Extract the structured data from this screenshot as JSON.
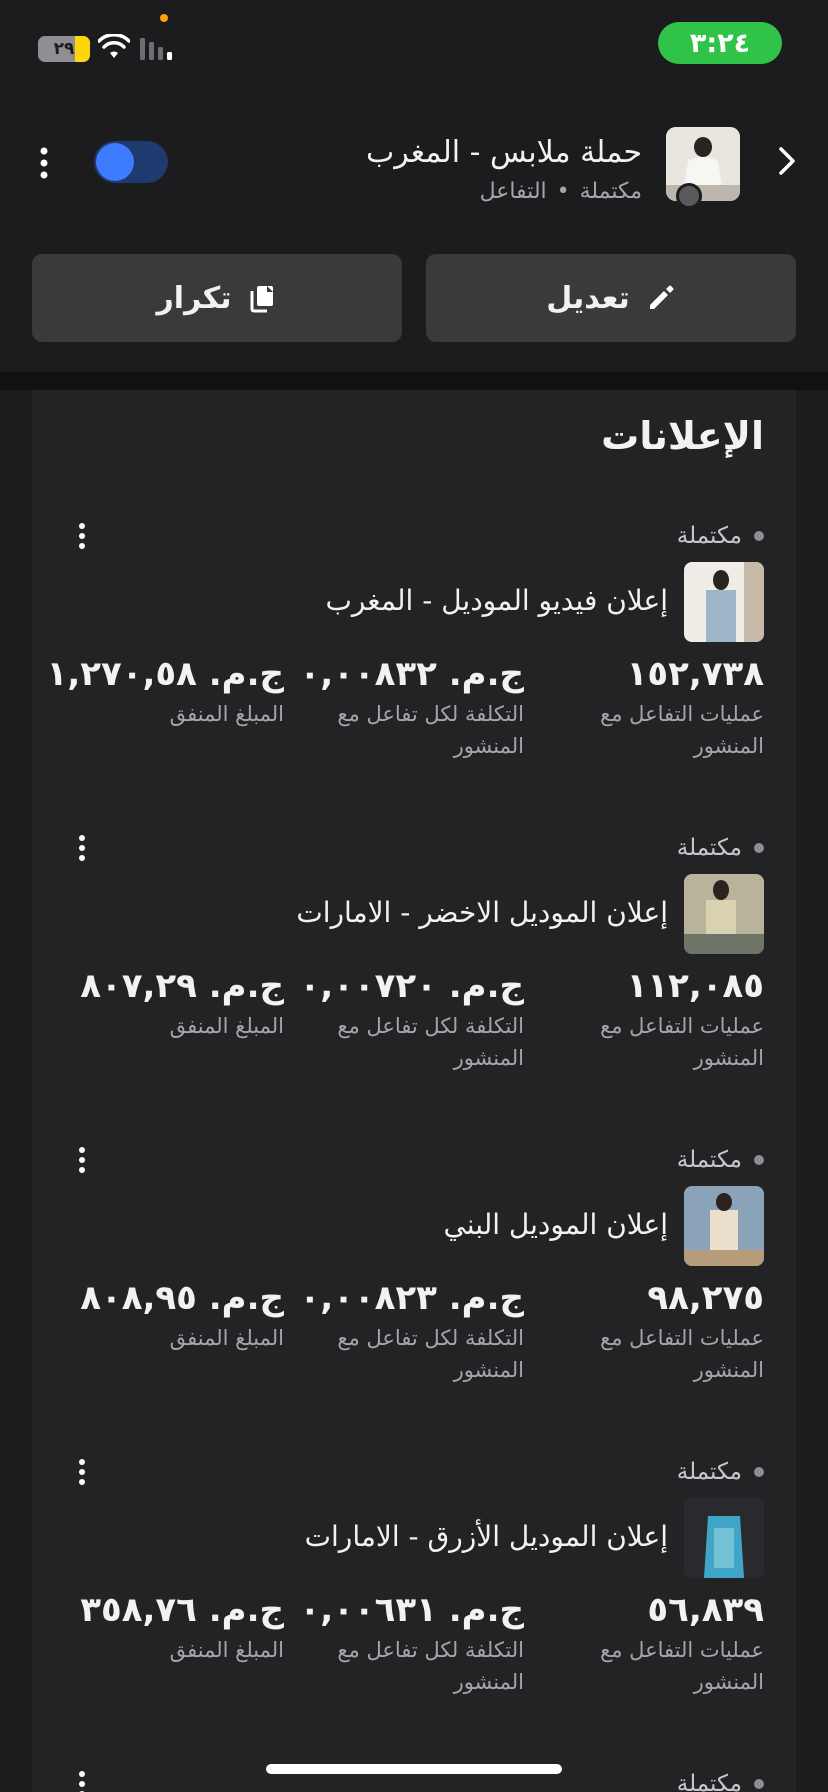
{
  "status_bar": {
    "time": "٣:٢٤",
    "battery": "٢٩",
    "battery_level": 0.29,
    "icons": [
      "wifi-icon",
      "cellular-signal-icon"
    ]
  },
  "header": {
    "campaign_name": "حملة ملابس - المغرب",
    "status": "مكتملة",
    "separator": "•",
    "objective": "التفاعل",
    "toggle_on": false,
    "icons": [
      "chevron-right-icon",
      "more-vertical-icon"
    ]
  },
  "actions": {
    "edit_label": "تعديل",
    "duplicate_label": "تكرار",
    "icons": [
      "pencil-icon",
      "copy-icon"
    ]
  },
  "ads_section": {
    "title": "الإعلانات",
    "ads": [
      {
        "status": "مكتملة",
        "name": "إعلان فيديو الموديل - المغرب",
        "engagements": "١٥٢,٧٣٨",
        "engagements_label": "عمليات  التفاعل مع المنشور",
        "cost_per": "ج.م. ٠,٠٠٨٣٢",
        "cost_per_label": "التكلفة لكل تفاعل مع المنشور",
        "spent": "ج.م. ١,٢٧٠,٥٨",
        "spent_label": "المبلغ المنفق",
        "thumb_colors": [
          "#f0ece6",
          "#9fb6c9",
          "#c9b9a8"
        ]
      },
      {
        "status": "مكتملة",
        "name": "إعلان الموديل الاخضر - الامارات",
        "engagements": "١١٢,٠٨٥",
        "engagements_label": "عمليات  التفاعل مع المنشور",
        "cost_per": "ج.م. ٠,٠٠٧٢٠",
        "cost_per_label": "التكلفة لكل تفاعل مع المنشور",
        "spent": "ج.م. ٨٠٧,٢٩",
        "spent_label": "المبلغ المنفق",
        "thumb_colors": [
          "#b8b39a",
          "#d8d2b0",
          "#6f7468"
        ]
      },
      {
        "status": "مكتملة",
        "name": "إعلان الموديل البني",
        "engagements": "٩٨,٢٧٥",
        "engagements_label": "عمليات  التفاعل مع المنشور",
        "cost_per": "ج.م. ٠,٠٠٨٢٣",
        "cost_per_label": "التكلفة لكل تفاعل مع المنشور",
        "spent": "ج.م. ٨٠٨,٩٥",
        "spent_label": "المبلغ المنفق",
        "thumb_colors": [
          "#8aa3b8",
          "#e9dfcc",
          "#b79c7c"
        ]
      },
      {
        "status": "مكتملة",
        "name": "إعلان الموديل الأزرق - الامارات",
        "engagements": "٥٦,٨٣٩",
        "engagements_label": "عمليات  التفاعل مع المنشور",
        "cost_per": "ج.م. ٠,٠٠٦٣١",
        "cost_per_label": "التكلفة لكل تفاعل مع المنشور",
        "spent": "ج.م. ٣٥٨,٧٦",
        "spent_label": "المبلغ المنفق",
        "thumb_colors": [
          "#2a2a2e",
          "#3fa6c8",
          "#9ad3e0"
        ]
      },
      {
        "status": "مكتملة"
      }
    ]
  },
  "colors": {
    "background": "#1c1c1e",
    "panel": "#232325",
    "button": "#3a3a3c",
    "toggle_track": "#1e3a6e",
    "toggle_knob": "#3d7bff",
    "time_pill": "#30c34a",
    "battery_fill": "#ffd60a"
  }
}
